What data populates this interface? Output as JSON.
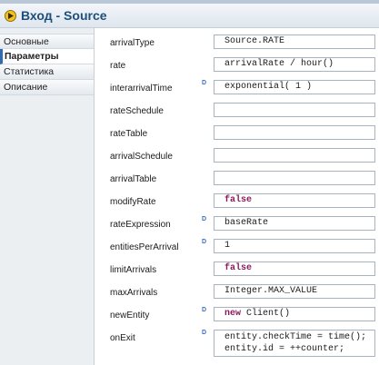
{
  "title": {
    "text": "Вход - Source",
    "icon": "play-circle-icon",
    "icon_color": "#f3c21c"
  },
  "sidebar": {
    "tabs": [
      {
        "label": "Основные",
        "active": false
      },
      {
        "label": "Параметры",
        "active": true
      },
      {
        "label": "Статистика",
        "active": false
      },
      {
        "label": "Описание",
        "active": false
      }
    ]
  },
  "params": [
    {
      "label": "arrivalType",
      "value": "Source.RATE"
    },
    {
      "label": "rate",
      "value": "arrivalRate / hour()"
    },
    {
      "label": "interarrivalTime",
      "dynamic": "D",
      "value": "exponential( 1 )"
    },
    {
      "label": "rateSchedule",
      "value": ""
    },
    {
      "label": "rateTable",
      "value": ""
    },
    {
      "label": "arrivalSchedule",
      "value": ""
    },
    {
      "label": "arrivalTable",
      "value": ""
    },
    {
      "label": "modifyRate",
      "value": "false",
      "keyword": true
    },
    {
      "label": "rateExpression",
      "dynamic": "D",
      "value": "baseRate"
    },
    {
      "label": "entitiesPerArrival",
      "dynamic": "D",
      "value": "1"
    },
    {
      "label": "limitArrivals",
      "value": "false",
      "keyword": true
    },
    {
      "label": "maxArrivals",
      "value": "Integer.MAX_VALUE"
    },
    {
      "label": "newEntity",
      "dynamic": "D",
      "value_keyword": "new",
      "value_rest": " Client()"
    },
    {
      "label": "onExit",
      "dynamic": "D",
      "value": "entity.checkTime = time();\nentity.id = ++counter;"
    }
  ],
  "colors": {
    "keyword": "#8b1a5c",
    "dynamic_marker": "#3b6fc1",
    "title_text": "#1d4f7c"
  }
}
